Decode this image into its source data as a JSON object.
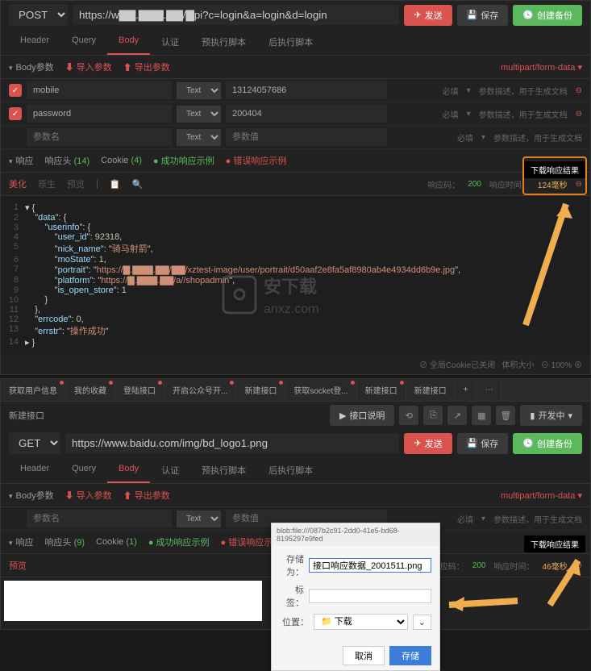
{
  "top": {
    "method": "POST",
    "url": "https://w▇▇.▇▇▇.▇▇/▇pi?c=login&a=login&d=login",
    "send": "发送",
    "save": "保存",
    "backup": "创建备份",
    "tabs": [
      "Header",
      "Query",
      "Body",
      "认证",
      "预执行脚本",
      "后执行脚本"
    ],
    "active_tab": 2,
    "body_params": "Body参数",
    "import": "导入参数",
    "export": "导出参数",
    "content_type": "multipart/form-data",
    "params": [
      {
        "checked": true,
        "name": "mobile",
        "type": "Text",
        "value": "13124057686",
        "required": "必填",
        "desc": "参数描述，用于生成文档"
      },
      {
        "checked": true,
        "name": "password",
        "type": "Text",
        "value": "200404",
        "required": "必填",
        "desc": "参数描述，用于生成文档"
      },
      {
        "checked": false,
        "name": "参数名",
        "type": "Text",
        "value": "参数值",
        "required": "必填",
        "desc": "参数描述，用于生成文档"
      }
    ],
    "response_tabs": {
      "response": "响应",
      "headers": "响应头",
      "headers_count": "(14)",
      "cookie": "Cookie",
      "cookie_count": "(4)",
      "success": "成功响应示例",
      "error": "错误响应示例"
    },
    "view_tabs": {
      "beauty": "美化",
      "raw": "原生",
      "preview": "预览"
    },
    "tooltip": "下载响应结果",
    "status_code": "响应码：",
    "status_val": "200",
    "time_label": "响应时间：",
    "time_val": "124毫秒",
    "json": {
      "data_key": "data",
      "userinfo_key": "userinfo",
      "user_id_key": "user_id",
      "user_id_val": "92318",
      "nick_key": "nick_name",
      "nick_val": "骑马射箭",
      "mostate_key": "moState",
      "mostate_val": "1",
      "portrait_key": "portrait",
      "portrait_val": "https://▇.▇▇▇.▇▇/▇▇/xztest-image/user/portrait/d50aaf2e8fa5af8980ab4e4934dd6b9e.jpg",
      "platform_key": "platform",
      "platform_val": "https://▇.▇▇▇.▇▇/a//shopadmin",
      "isopen_key": "is_open_store",
      "isopen_val": "1",
      "errcode_key": "errcode",
      "errcode_val": "0",
      "errstr_key": "errstr",
      "errstr_val": "操作成功"
    },
    "footer": {
      "cookie": "全局Cookie已关闭",
      "size": "体积大小",
      "size_val": "—",
      "zoom": "100%"
    }
  },
  "bottom": {
    "file_tabs": [
      "获取用户信息",
      "我的收藏",
      "登陆接口",
      "开启公众号开...",
      "新建接口",
      "获取socket登...",
      "新建接口",
      "新建接口"
    ],
    "add": "+",
    "title": "新建接口",
    "desc_btn": "接口说明",
    "dev_btn": "开发中",
    "method": "GET",
    "url": "https://www.baidu.com/img/bd_logo1.png",
    "send": "发送",
    "save": "保存",
    "backup": "创建备份",
    "tabs": [
      "Header",
      "Query",
      "Body",
      "认证",
      "预执行脚本",
      "后执行脚本"
    ],
    "active_tab": 2,
    "body_params": "Body参数",
    "import": "导入参数",
    "export": "导出参数",
    "content_type": "multipart/form-data",
    "param": {
      "name": "参数名",
      "type": "Text",
      "value": "参数值",
      "required": "必填",
      "desc": "参数描述，用于生成文档"
    },
    "response_tabs": {
      "response": "响应",
      "headers": "响应头",
      "headers_count": "(9)",
      "cookie": "Cookie",
      "cookie_count": "(1)",
      "success": "成功响应示例",
      "error": "错误响应示例"
    },
    "preview": "预览",
    "tooltip": "下载响应结果",
    "status_code": "响应码：",
    "status_val": "200",
    "time_label": "响应时间：",
    "time_val": "46毫秒",
    "dialog": {
      "head": "blob:file:///087b2c91-2dd0-41e5-bd68-8195297e9fed",
      "save_as": "存储为：",
      "filename": "接口响应数据_2001511.png",
      "tags": "标签：",
      "location": "位置：",
      "folder": "下载",
      "cancel": "取消",
      "save": "存储"
    }
  }
}
